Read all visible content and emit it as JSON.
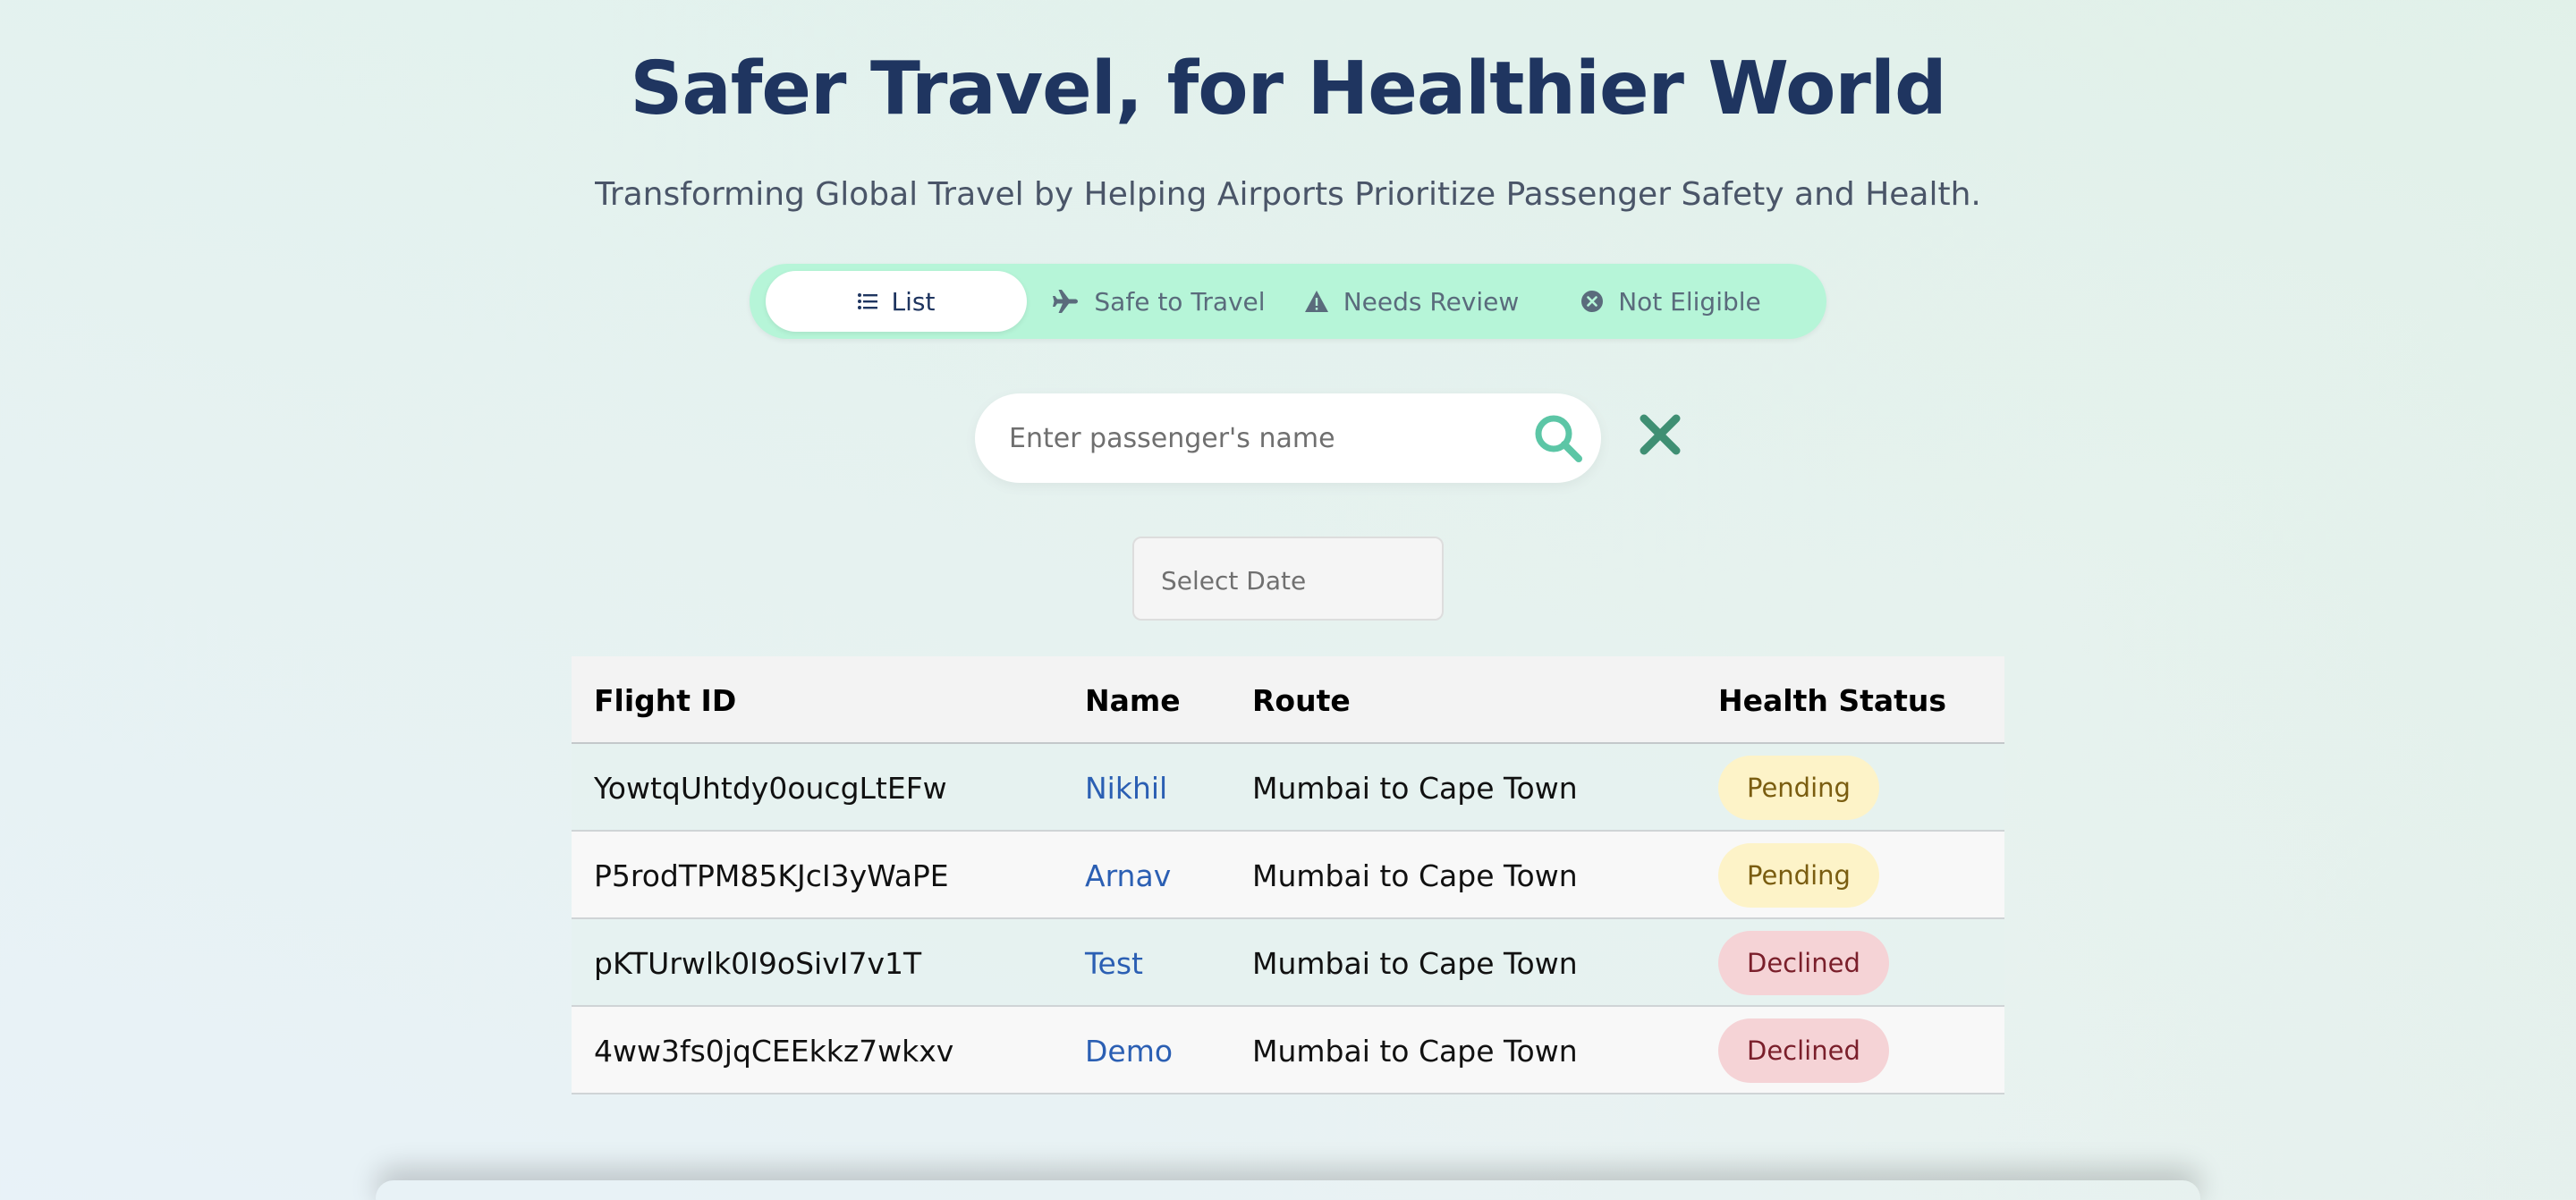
{
  "header": {
    "title": "Safer Travel, for Healthier World",
    "subtitle": "Transforming Global Travel by Helping Airports Prioritize Passenger Safety and Health."
  },
  "tabs": [
    {
      "label": "List",
      "icon": "list-icon",
      "active": true
    },
    {
      "label": "Safe to Travel",
      "icon": "plane-icon",
      "active": false
    },
    {
      "label": "Needs Review",
      "icon": "warning-icon",
      "active": false
    },
    {
      "label": "Not Eligible",
      "icon": "x-circle-icon",
      "active": false
    }
  ],
  "search": {
    "placeholder": "Enter passenger's name",
    "value": "",
    "search_icon": "search-icon",
    "clear_icon": "close-icon"
  },
  "date_picker": {
    "placeholder": "Select Date"
  },
  "table": {
    "columns": [
      "Flight ID",
      "Name",
      "Route",
      "Health Status"
    ],
    "rows": [
      {
        "flight_id": "YowtqUhtdy0oucgLtEFw",
        "name": "Nikhil",
        "route": "Mumbai to Cape Town",
        "status": "Pending"
      },
      {
        "flight_id": "P5rodTPM85KJcI3yWaPE",
        "name": "Arnav",
        "route": "Mumbai to Cape Town",
        "status": "Pending"
      },
      {
        "flight_id": "pKTUrwlk0I9oSivI7v1T",
        "name": "Test",
        "route": "Mumbai to Cape Town",
        "status": "Declined"
      },
      {
        "flight_id": "4ww3fs0jqCEEkkz7wkxv",
        "name": "Demo",
        "route": "Mumbai to Cape Town",
        "status": "Declined"
      }
    ]
  },
  "colors": {
    "title": "#1f3560",
    "tab_bar": "#b6f5d8",
    "accent": "#5cc6a6",
    "link": "#2b5fb3",
    "pending_bg": "#fdf3c8",
    "declined_bg": "#f5d3d6"
  }
}
